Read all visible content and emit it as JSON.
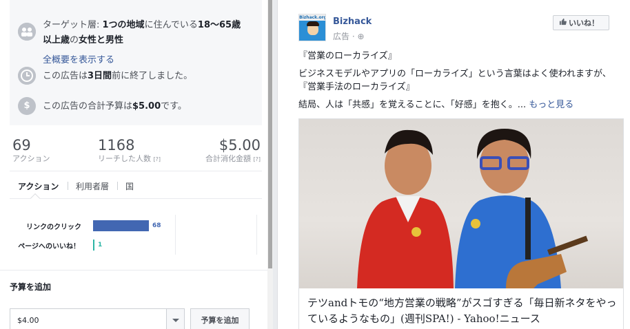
{
  "summary": {
    "target_text": "ターゲット層: 1つの地域に住んでいる18〜65歳以上歳の女性と男性",
    "target_parts": [
      "ターゲット層: ",
      "1つの地域",
      "に住んでいる",
      "18〜65歳",
      "以上歳",
      "の",
      "女性と男性"
    ],
    "overview_link": "全概要を表示する",
    "ended_parts": [
      "この広告は",
      "3日間",
      "前に終了しました。"
    ],
    "budget_parts": [
      "この広告の合計予算は",
      "$5.00",
      "です。"
    ]
  },
  "stats": [
    {
      "value": "69",
      "label": "アクション",
      "help": ""
    },
    {
      "value": "1168",
      "label": "リーチした人数",
      "help": "[?]"
    },
    {
      "value": "$5.00",
      "label": "合計消化金額",
      "help": "[?]"
    }
  ],
  "tabs": [
    "アクション",
    "利用者層",
    "国"
  ],
  "actions_chart": {
    "type": "bar",
    "categories": [
      "リンクのクリック",
      "ページへのいいね！"
    ],
    "values": [
      68,
      1
    ],
    "colors": [
      "#4267b2",
      "#2bb5a5"
    ]
  },
  "add_budget": {
    "title": "予算を追加",
    "amount": "$4.00",
    "button": "予算を追加"
  },
  "ad": {
    "avatar_text": "Bizhack.org",
    "page_name": "Bizhack",
    "sponsored": "広告 · ",
    "globe": "⊕",
    "like_button": "いいね！",
    "line1": "『営業のローカライズ』",
    "line2": "ビジネスモデルやアプリの「ローカライズ」という言葉はよく使われますが、『営業手法のローカライズ』",
    "line3": "結局、人は「共感」を覚えることに、「好感」を抱く。... ",
    "more": "もっと見る",
    "link_title": "テツandトモの“地方営業の戦略”がスゴすぎる「毎日新ネタをやっているようなもの」(週刊SPA!) - Yahoo!ニュース"
  }
}
